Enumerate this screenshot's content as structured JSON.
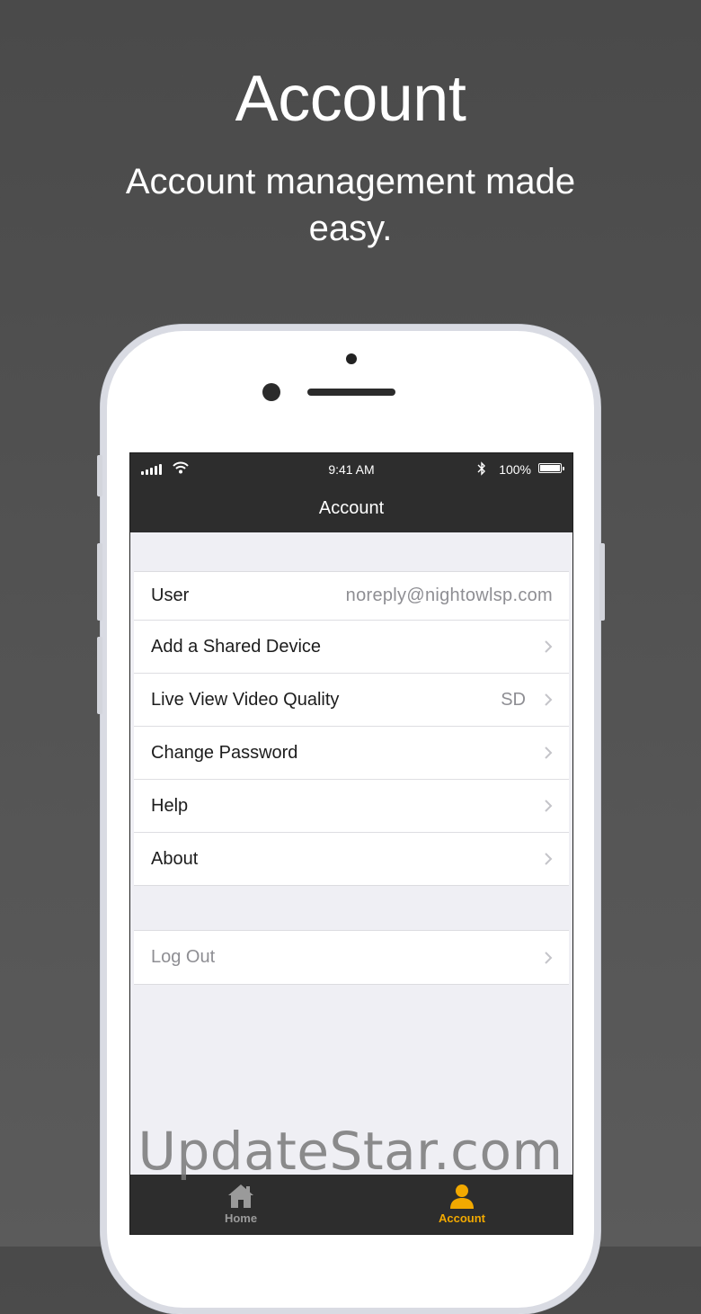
{
  "promo": {
    "headline": "Account",
    "subheadline": "Account management made easy."
  },
  "status_bar": {
    "time": "9:41 AM",
    "battery": "100%"
  },
  "nav": {
    "title": "Account"
  },
  "account_rows": [
    {
      "label": "User",
      "value": "noreply@nightowlsp.com"
    },
    {
      "label": "Add a Shared Device"
    },
    {
      "label": "Live View Video Quality",
      "value": "SD"
    },
    {
      "label": "Change Password"
    },
    {
      "label": "Help"
    },
    {
      "label": "About"
    }
  ],
  "logout": {
    "label": "Log Out"
  },
  "tabs": [
    {
      "label": "Home",
      "icon": "home-icon",
      "active": false
    },
    {
      "label": "Account",
      "icon": "user-icon",
      "active": true
    }
  ],
  "colors": {
    "bar_background": "#2d2d2d",
    "accent": "#f2a900",
    "inactive_tab": "#9a9a9a",
    "group_background": "#efeff4"
  },
  "watermark": "UpdateStar.com"
}
